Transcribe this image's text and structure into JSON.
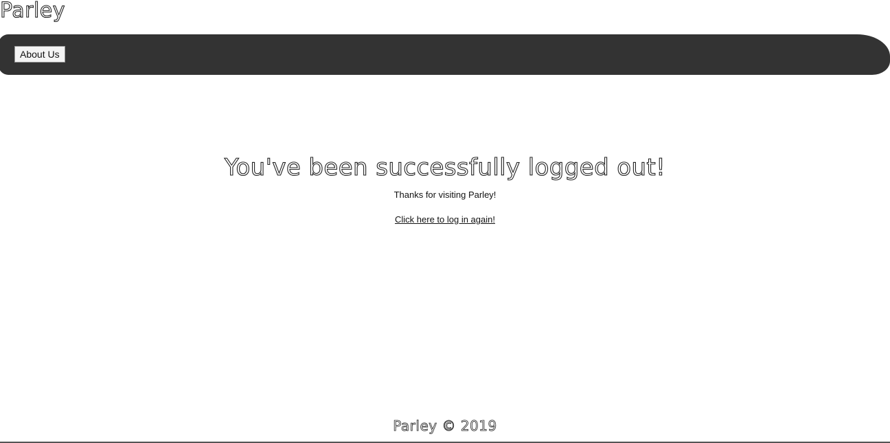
{
  "header": {
    "site_title": "Parley"
  },
  "nav": {
    "about_label": "About Us"
  },
  "main": {
    "headline": "You've been successfully logged out!",
    "thanks": "Thanks for visiting Parley!",
    "login_link": "Click here to log in again!"
  },
  "footer": {
    "copyright": "Parley © 2019"
  },
  "colors": {
    "navbar_bg": "#333333",
    "page_bg": "#ffffff",
    "text": "#111111"
  }
}
